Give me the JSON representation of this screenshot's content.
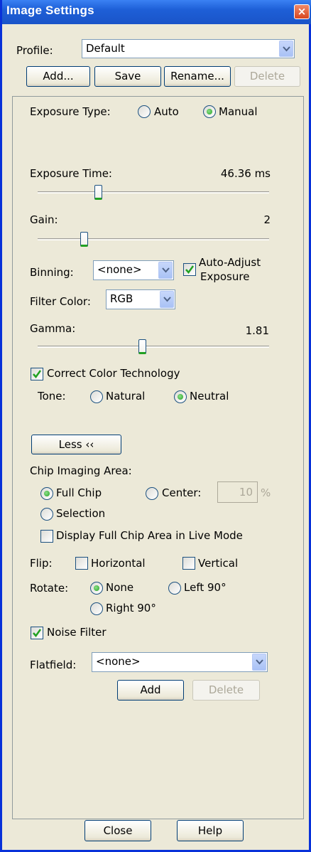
{
  "window": {
    "title": "Image Settings",
    "close_glyph": "×"
  },
  "profile": {
    "label": "Profile:",
    "value": "Default"
  },
  "profile_buttons": {
    "add": "Add...",
    "save": "Save",
    "rename": "Rename...",
    "delete": "Delete"
  },
  "exposure_type": {
    "label": "Exposure Type:",
    "options": [
      "Auto",
      "Manual"
    ],
    "selected": "Manual"
  },
  "exposure_time": {
    "label": "Exposure Time:",
    "value": "46.36 ms",
    "slider_fraction": 0.26
  },
  "gain": {
    "label": "Gain:",
    "value": "2",
    "slider_fraction": 0.2
  },
  "binning": {
    "label": "Binning:",
    "value": "<none>"
  },
  "auto_adjust": {
    "label_line1": "Auto-Adjust",
    "label_line2": "Exposure",
    "checked": true
  },
  "filter_color": {
    "label": "Filter Color:",
    "value": "RGB"
  },
  "gamma": {
    "label": "Gamma:",
    "value": "1.81",
    "slider_fraction": 0.45
  },
  "correct_color": {
    "label": "Correct Color Technology",
    "checked": true
  },
  "tone": {
    "label": "Tone:",
    "options": [
      "Natural",
      "Neutral"
    ],
    "selected": "Neutral"
  },
  "less_button": {
    "label": "Less ‹‹"
  },
  "chip_area": {
    "label": "Chip Imaging Area:",
    "full_chip": "Full Chip",
    "center": "Center:",
    "center_value": "10",
    "center_unit": "%",
    "selection": "Selection",
    "selected": "Full Chip"
  },
  "display_full_chip": {
    "label": "Display Full Chip Area in Live Mode",
    "checked": false
  },
  "flip": {
    "label": "Flip:",
    "horizontal": "Horizontal",
    "vertical": "Vertical"
  },
  "rotate": {
    "label": "Rotate:",
    "none": "None",
    "left": "Left 90°",
    "right": "Right 90°",
    "selected": "None"
  },
  "noise_filter": {
    "label": "Noise Filter",
    "checked": true
  },
  "flatfield": {
    "label": "Flatfield:",
    "value": "<none>",
    "add": "Add",
    "delete": "Delete"
  },
  "footer": {
    "close": "Close",
    "help": "Help"
  },
  "colors": {
    "title_bar": "#1e5fd7",
    "dialog_bg": "#ece9d8",
    "radio_on": "#21a121"
  }
}
